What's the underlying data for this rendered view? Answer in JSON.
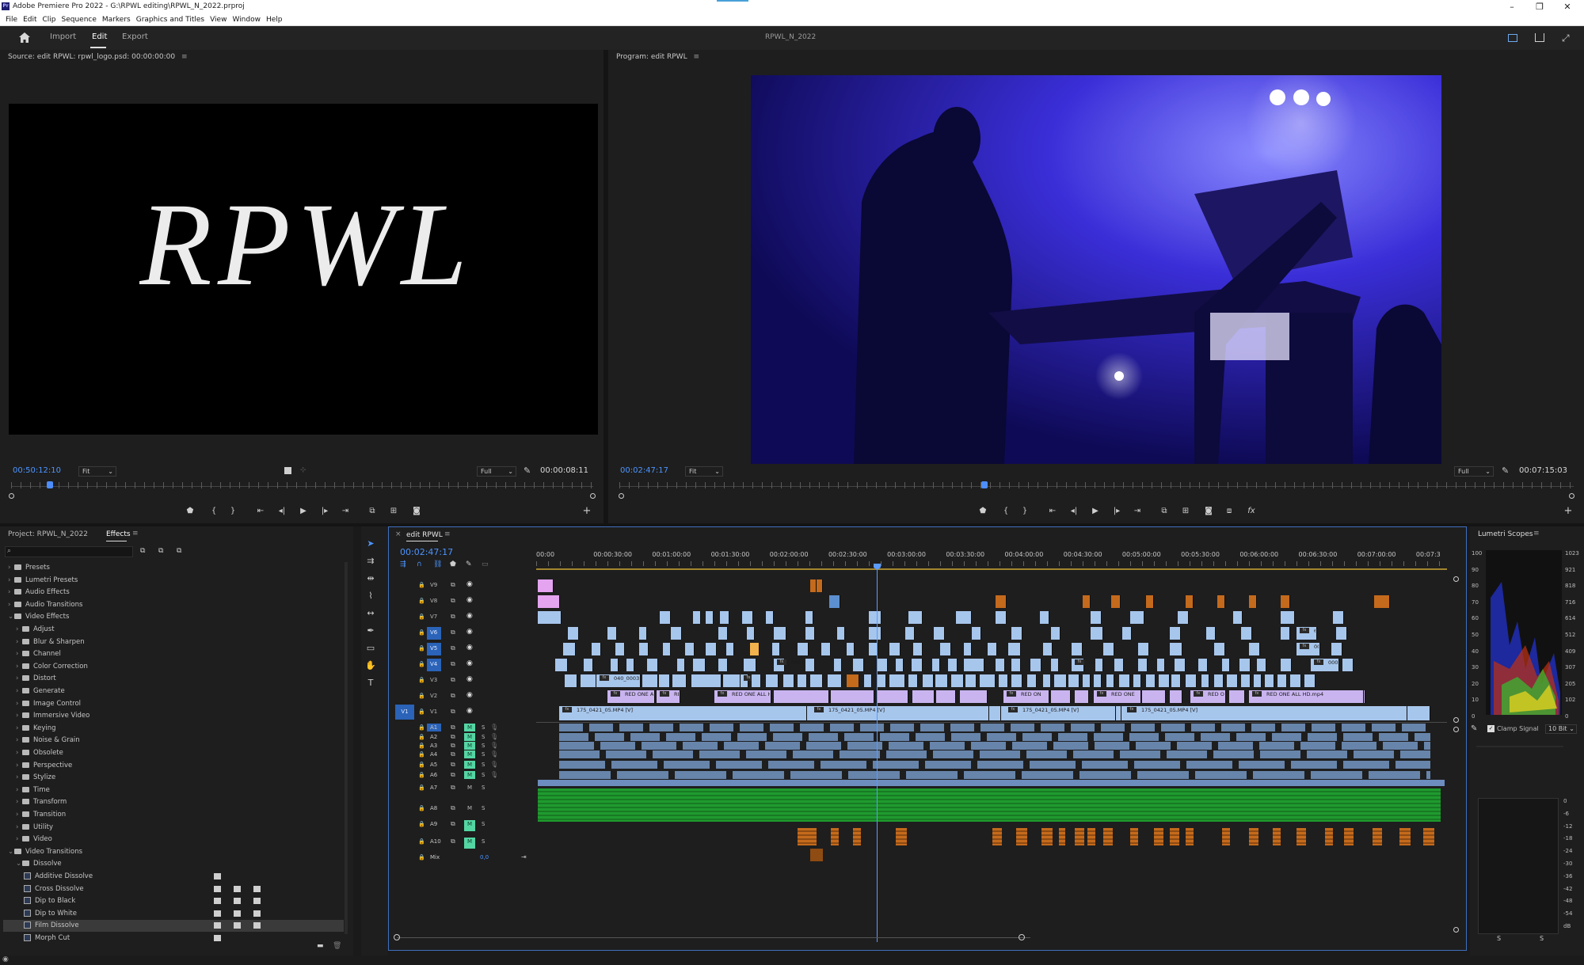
{
  "app": {
    "window_title": "Adobe Premiere Pro 2022 - G:\\RPWL editing\\RPWL_N_2022.prproj",
    "logo_text": "Pr",
    "window_controls": [
      "–",
      "❐",
      "✕"
    ]
  },
  "menu": [
    "File",
    "Edit",
    "Clip",
    "Sequence",
    "Markers",
    "Graphics and Titles",
    "View",
    "Window",
    "Help"
  ],
  "workspace": {
    "tabs": [
      "Import",
      "Edit",
      "Export"
    ],
    "active_tab": "Edit",
    "project_title": "RPWL_N_2022"
  },
  "source_monitor": {
    "header": "Source: edit RPWL: rpwl_logo.psd: 00:00:00:00",
    "logo_text": "RPWL",
    "timecode_in": "00:50:12:10",
    "zoom": "Fit",
    "resolution": "Full",
    "duration": "00:00:08:11"
  },
  "program_monitor": {
    "header": "Program: edit RPWL",
    "timecode": "00:02:47:17",
    "zoom": "Fit",
    "resolution": "Full",
    "duration": "00:07:15:03"
  },
  "project_panel": {
    "tabs": [
      "Project: RPWL_N_2022",
      "Effects"
    ],
    "active_tab": "Effects",
    "tree": [
      {
        "label": "Presets",
        "level": 0,
        "type": "folder",
        "open": false
      },
      {
        "label": "Lumetri Presets",
        "level": 0,
        "type": "folder",
        "open": false
      },
      {
        "label": "Audio Effects",
        "level": 0,
        "type": "folder",
        "open": false
      },
      {
        "label": "Audio Transitions",
        "level": 0,
        "type": "folder",
        "open": false
      },
      {
        "label": "Video Effects",
        "level": 0,
        "type": "folder",
        "open": true
      },
      {
        "label": "Adjust",
        "level": 1,
        "type": "folder",
        "open": false
      },
      {
        "label": "Blur & Sharpen",
        "level": 1,
        "type": "folder",
        "open": false
      },
      {
        "label": "Channel",
        "level": 1,
        "type": "folder",
        "open": false
      },
      {
        "label": "Color Correction",
        "level": 1,
        "type": "folder",
        "open": false
      },
      {
        "label": "Distort",
        "level": 1,
        "type": "folder",
        "open": false
      },
      {
        "label": "Generate",
        "level": 1,
        "type": "folder",
        "open": false
      },
      {
        "label": "Image Control",
        "level": 1,
        "type": "folder",
        "open": false
      },
      {
        "label": "Immersive Video",
        "level": 1,
        "type": "folder",
        "open": false
      },
      {
        "label": "Keying",
        "level": 1,
        "type": "folder",
        "open": false
      },
      {
        "label": "Noise & Grain",
        "level": 1,
        "type": "folder",
        "open": false
      },
      {
        "label": "Obsolete",
        "level": 1,
        "type": "folder",
        "open": false
      },
      {
        "label": "Perspective",
        "level": 1,
        "type": "folder",
        "open": false
      },
      {
        "label": "Stylize",
        "level": 1,
        "type": "folder",
        "open": false
      },
      {
        "label": "Time",
        "level": 1,
        "type": "folder",
        "open": false
      },
      {
        "label": "Transform",
        "level": 1,
        "type": "folder",
        "open": false
      },
      {
        "label": "Transition",
        "level": 1,
        "type": "folder",
        "open": false
      },
      {
        "label": "Utility",
        "level": 1,
        "type": "folder",
        "open": false
      },
      {
        "label": "Video",
        "level": 1,
        "type": "folder",
        "open": false
      },
      {
        "label": "Video Transitions",
        "level": 0,
        "type": "folder",
        "open": true
      },
      {
        "label": "Dissolve",
        "level": 1,
        "type": "folder",
        "open": true
      },
      {
        "label": "Additive Dissolve",
        "level": 2,
        "type": "effect",
        "badges": 1
      },
      {
        "label": "Cross Dissolve",
        "level": 2,
        "type": "effect",
        "badges": 3
      },
      {
        "label": "Dip to Black",
        "level": 2,
        "type": "effect",
        "badges": 3
      },
      {
        "label": "Dip to White",
        "level": 2,
        "type": "effect",
        "badges": 3
      },
      {
        "label": "Film Dissolve",
        "level": 2,
        "type": "effect",
        "badges": 3,
        "selected": true
      },
      {
        "label": "Morph Cut",
        "level": 2,
        "type": "effect",
        "badges": 1
      }
    ]
  },
  "timeline": {
    "tab": "edit RPWL",
    "timecode": "00:02:47:17",
    "ruler": [
      "00:00",
      "00:00:30:00",
      "00:01:00:00",
      "00:01:30:00",
      "00:02:00:00",
      "00:02:30:00",
      "00:03:00:00",
      "00:03:30:00",
      "00:04:00:00",
      "00:04:30:00",
      "00:05:00:00",
      "00:05:30:00",
      "00:06:00:00",
      "00:06:30:00",
      "00:07:00:00",
      "00:07:3"
    ],
    "video_tracks": [
      "V9",
      "V8",
      "V7",
      "V6",
      "V5",
      "V4",
      "V3",
      "V2",
      "V1"
    ],
    "source_patch": "V1",
    "audio_tracks": [
      "A1",
      "A2",
      "A3",
      "A4",
      "A5",
      "A6",
      "A7",
      "A8",
      "A9",
      "A10"
    ],
    "mix_label": "Mix",
    "mix_value": "0,0",
    "clip_labels": {
      "v1_a": "175_0421_05.MP4 [V]",
      "v1_b": "175_0421_05.MP4 [V]",
      "v1_c": "175_0421_05.MP4 [V]",
      "v1_d": "175_0421_05.MP4 [V]",
      "v2_a": "RED ONE ALL",
      "v2_b": "RED",
      "v2_c": "RED ONE ALL H",
      "v2_d": "RED ON",
      "v2_e": "RED ONE",
      "v2_f": "RED O",
      "v2_g": "RED ONE ALL HD.mp4",
      "v3_a": "040_0003_01",
      "v3_b": "040_0",
      "v4_a": "0001",
      "v4_b": "0001",
      "v4_c": "00013.M",
      "v5_a": "000",
      "v6_a": "653"
    }
  },
  "lumetri": {
    "title": "Lumetri Scopes",
    "left_scale": [
      "100",
      "90",
      "80",
      "70",
      "60",
      "50",
      "40",
      "30",
      "20",
      "10",
      "0"
    ],
    "right_scale": [
      "1023",
      "921",
      "818",
      "716",
      "614",
      "512",
      "409",
      "307",
      "205",
      "102",
      "0"
    ],
    "clamp_label": "Clamp Signal",
    "bit_depth": "10 Bit",
    "meter_scale": [
      "0",
      "-6",
      "-12",
      "-18",
      "-24",
      "-30",
      "-36",
      "-42",
      "-48",
      "-54",
      "dB"
    ],
    "meter_solo": [
      "S",
      "S"
    ]
  }
}
